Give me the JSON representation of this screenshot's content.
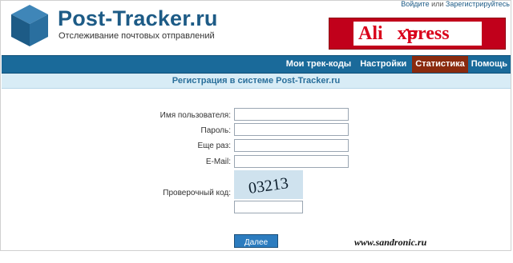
{
  "header": {
    "top_links": {
      "login": "Войдите",
      "or": "или",
      "register": "Зарегистрируйтесь"
    },
    "brand_title": "Post-Tracker.ru",
    "brand_subtitle": "Отслеживание почтовых отправлений",
    "ad": {
      "text_ali": "Ali",
      "text_express": "xpress",
      "brand_color": "#c1001b"
    }
  },
  "nav": {
    "items": [
      {
        "label": "Мои трек-коды"
      },
      {
        "label": "Настройки"
      },
      {
        "label": "Статистика",
        "active": true
      },
      {
        "label": "Помощь"
      }
    ],
    "bar_color": "#1a6a9a",
    "active_color": "#8a2a0e"
  },
  "page": {
    "title": "Регистрация в системе Post-Tracker.ru"
  },
  "form": {
    "username_label": "Имя пользователя:",
    "password_label": "Пароль:",
    "password_repeat_label": "Еще раз:",
    "email_label": "E-Mail:",
    "captcha_label": "Проверочный код:",
    "captcha_text": "03213",
    "submit_label": "Далее >>"
  },
  "watermark": "www.sandronic.ru"
}
